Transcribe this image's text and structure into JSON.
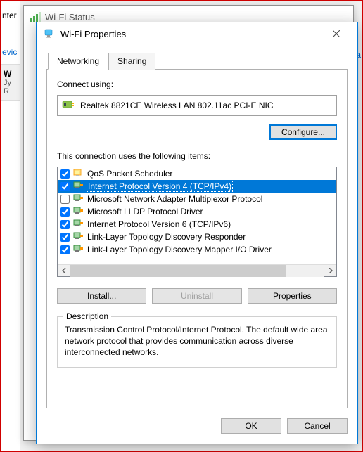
{
  "background": {
    "status_title": "Wi-Fi Status",
    "left_frag1": "nter",
    "left_frag2": "evic",
    "left_frag3": "W",
    "left_frag4": "Jy",
    "left_frag5": "R",
    "right_frag": "sta"
  },
  "dialog": {
    "title": "Wi-Fi Properties",
    "tabs": {
      "networking": "Networking",
      "sharing": "Sharing"
    },
    "connect_using_label": "Connect using:",
    "adapter_name": "Realtek 8821CE Wireless LAN 802.11ac PCI-E NIC",
    "configure_button": "Configure...",
    "items_label": "This connection uses the following items:",
    "items": [
      {
        "checked": true,
        "type": "component",
        "label": "QoS Packet Scheduler",
        "selected": false
      },
      {
        "checked": true,
        "type": "protocol",
        "label": "Internet Protocol Version 4 (TCP/IPv4)",
        "selected": true
      },
      {
        "checked": false,
        "type": "protocol",
        "label": "Microsoft Network Adapter Multiplexor Protocol",
        "selected": false
      },
      {
        "checked": true,
        "type": "protocol",
        "label": "Microsoft LLDP Protocol Driver",
        "selected": false
      },
      {
        "checked": true,
        "type": "protocol",
        "label": "Internet Protocol Version 6 (TCP/IPv6)",
        "selected": false
      },
      {
        "checked": true,
        "type": "protocol",
        "label": "Link-Layer Topology Discovery Responder",
        "selected": false
      },
      {
        "checked": true,
        "type": "protocol",
        "label": "Link-Layer Topology Discovery Mapper I/O Driver",
        "selected": false
      }
    ],
    "install_button": "Install...",
    "uninstall_button": "Uninstall",
    "properties_button": "Properties",
    "description_group": "Description",
    "description_text": "Transmission Control Protocol/Internet Protocol. The default wide area network protocol that provides communication across diverse interconnected networks.",
    "ok_button": "OK",
    "cancel_button": "Cancel"
  }
}
